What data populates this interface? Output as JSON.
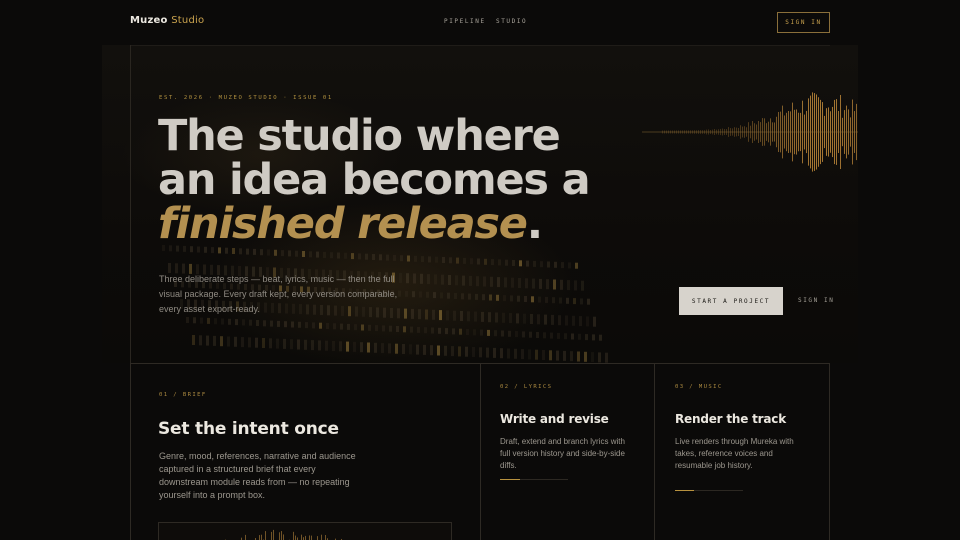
{
  "brand": {
    "name": "Muzeo",
    "accent": "Studio"
  },
  "nav": {
    "links": [
      "PIPELINE",
      "STUDIO"
    ],
    "signin_label": "SIGN IN"
  },
  "hero": {
    "eyebrow": "EST. 2026 · MUZEO STUDIO · ISSUE 01",
    "headline_line1": "The studio where",
    "headline_line2": "an idea becomes a",
    "headline_highlight": "finished release",
    "headline_period": ".",
    "lead": "Three deliberate steps — beat, lyrics, music — then the full visual package. Every draft kept, every version comparable, every asset export-ready.",
    "cta_primary": "START A PROJECT",
    "cta_secondary": "SIGN IN"
  },
  "cards": [
    {
      "step": "01 / BRIEF",
      "title": "Set the intent once",
      "body": "Genre, mood, references, narrative and audience captured in a structured brief that every downstream module reads from — no repeating yourself into a prompt box."
    },
    {
      "step": "02 / LYRICS",
      "title": "Write and revise",
      "body": "Draft, extend and branch lyrics with full version history and side-by-side diffs.",
      "progress": 0.3
    },
    {
      "step": "03 / MUSIC",
      "title": "Render the track",
      "body": "Live renders through Mureka with takes, reference voices and resumable job history.",
      "progress": 0.28
    }
  ],
  "colors": {
    "background": "#0b0a09",
    "accent_gold": "#c9a24e",
    "text_primary": "#ece8e0",
    "button_light": "#d7d3cc"
  }
}
